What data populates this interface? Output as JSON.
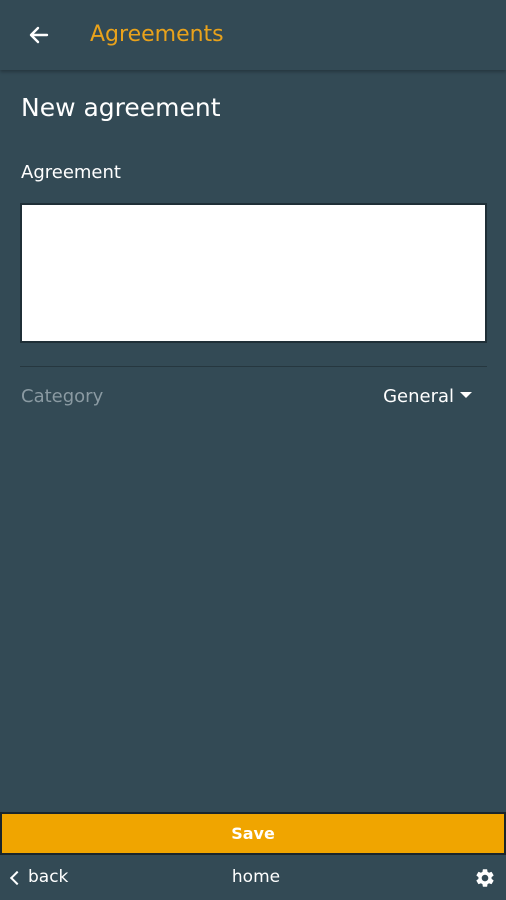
{
  "header": {
    "title": "Agreements",
    "back_icon": "arrow-left-icon",
    "accent_color": "#e9a21b"
  },
  "form": {
    "page_title": "New agreement",
    "agreement_label": "Agreement",
    "agreement_value": "",
    "category_label": "Category",
    "category_value": "General"
  },
  "actions": {
    "save_label": "Save",
    "save_color": "#f0a500"
  },
  "bottom_nav": {
    "back_label": "back",
    "home_label": "home",
    "settings_icon": "gear-icon"
  },
  "colors": {
    "background": "#334a55"
  }
}
